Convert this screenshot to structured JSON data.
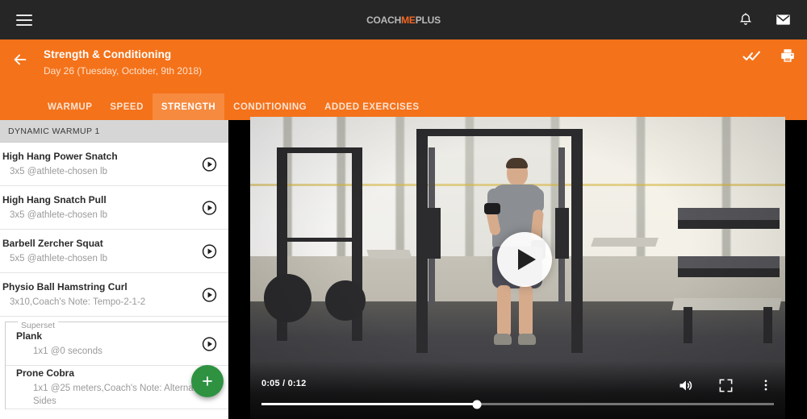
{
  "topbar": {
    "menu_icon": "hamburger-icon",
    "brand": {
      "part1": "COACH",
      "part2": "ME",
      "part3": "PLUS"
    },
    "notifications_icon": "bell-icon",
    "messages_icon": "envelope-icon"
  },
  "header": {
    "back_icon": "arrow-left-icon",
    "title": "Strength & Conditioning",
    "subtitle": "Day 26 (Tuesday, October, 9th 2018)",
    "done_all_icon": "double-check-icon",
    "print_icon": "printer-icon",
    "background_color": "#f4721a",
    "active_tab_color": "#f68a3f",
    "tabs": [
      {
        "label": "WARMUP",
        "active": false
      },
      {
        "label": "SPEED",
        "active": false
      },
      {
        "label": "STRENGTH",
        "active": true
      },
      {
        "label": "CONDITIONING",
        "active": false
      },
      {
        "label": "ADDED EXERCISES",
        "active": false
      }
    ]
  },
  "sidebar": {
    "group_title": "DYNAMIC WARMUP 1",
    "play_icon": "play-circle-icon",
    "exercises": [
      {
        "name": "High Hang Power Snatch",
        "detail": "3x5 @athlete-chosen lb"
      },
      {
        "name": "High Hang Snatch Pull",
        "detail": "3x5 @athlete-chosen lb"
      },
      {
        "name": "Barbell Zercher Squat",
        "detail": "5x5 @athlete-chosen lb"
      },
      {
        "name": "Physio Ball Hamstring Curl",
        "detail": "3x10,Coach's Note: Tempo-2-1-2"
      }
    ],
    "superset": {
      "label": "Superset",
      "exercises": [
        {
          "name": "Plank",
          "detail": "1x1 @0 seconds"
        },
        {
          "name": "Prone Cobra",
          "detail": "1x1 @25 meters,Coach's Note: Alternating Sides"
        }
      ]
    },
    "add_button": {
      "icon": "plus-icon",
      "color": "#2e9241"
    }
  },
  "video": {
    "play_overlay_icon": "play-triangle-icon",
    "current_time": "0:05",
    "total_time": "0:12",
    "time_display": "0:05 / 0:12",
    "progress_percent": 42,
    "volume_icon": "volume-up-icon",
    "fullscreen_icon": "fullscreen-icon",
    "more_icon": "kebab-menu-icon"
  }
}
